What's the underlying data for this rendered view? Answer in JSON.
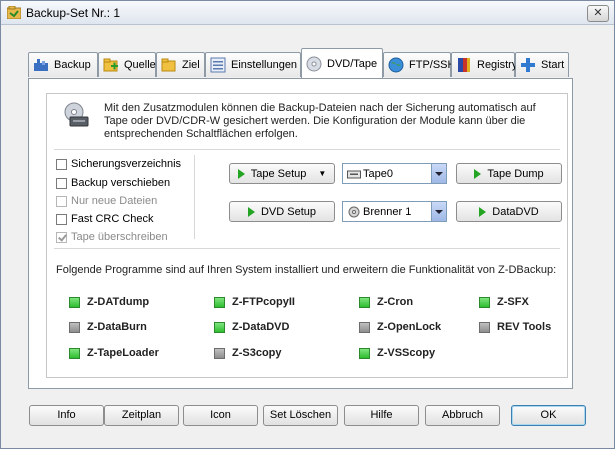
{
  "window": {
    "title": "Backup-Set Nr.: 1",
    "close_label": "✕"
  },
  "tabs": [
    {
      "label": "Backup",
      "icon": "backup-icon"
    },
    {
      "label": "Quelle",
      "icon": "source-folder-icon"
    },
    {
      "label": "Ziel",
      "icon": "target-folder-icon"
    },
    {
      "label": "Einstellungen",
      "icon": "settings-icon"
    },
    {
      "label": "DVD/Tape",
      "icon": "cd-icon",
      "active": true
    },
    {
      "label": "FTP/SSH",
      "icon": "globe-icon"
    },
    {
      "label": "Registry",
      "icon": "registry-icon"
    },
    {
      "label": "Start",
      "icon": "plus-icon"
    }
  ],
  "intro_text": "Mit den Zusatzmodulen  können die Backup-Dateien nach der Sicherung automatisch auf Tape oder DVD/CDR-W gesichert werden. Die Konfiguration der Module kann über die entsprechenden Schaltflächen erfolgen.",
  "options": [
    {
      "label": "Sicherungsverzeichnis",
      "checked": false,
      "enabled": true
    },
    {
      "label": "Backup verschieben",
      "checked": false,
      "enabled": true
    },
    {
      "label": "Nur neue Dateien",
      "checked": false,
      "enabled": false
    },
    {
      "label": "Fast CRC Check",
      "checked": false,
      "enabled": true
    },
    {
      "label": "Tape überschreiben",
      "checked": true,
      "enabled": false
    }
  ],
  "tape": {
    "setup_label": "Tape Setup",
    "device": "Tape0",
    "dump_label": "Tape Dump"
  },
  "dvd": {
    "setup_label": "DVD Setup",
    "device": "Brenner 1",
    "data_label": "DataDVD"
  },
  "installed_text": "Folgende Programme sind auf Ihren System installiert und erweitern die Funktionalität von Z-DBackup:",
  "modules": [
    {
      "name": "Z-DATdump",
      "installed": true
    },
    {
      "name": "Z-FTPcopyII",
      "installed": true
    },
    {
      "name": "Z-Cron",
      "installed": true
    },
    {
      "name": "Z-SFX",
      "installed": true
    },
    {
      "name": "Z-DataBurn",
      "installed": false
    },
    {
      "name": "Z-DataDVD",
      "installed": true
    },
    {
      "name": "Z-OpenLock",
      "installed": false
    },
    {
      "name": "REV Tools",
      "installed": false
    },
    {
      "name": "Z-TapeLoader",
      "installed": true
    },
    {
      "name": "Z-S3copy",
      "installed": false
    },
    {
      "name": "Z-VSScopy",
      "installed": true
    }
  ],
  "buttons": {
    "info": "Info",
    "zeitplan": "Zeitplan",
    "icon": "Icon",
    "set_loeschen": "Set Löschen",
    "hilfe": "Hilfe",
    "abbruch": "Abbruch",
    "ok": "OK"
  },
  "colors": {
    "installed": "#2fbd2f",
    "not_installed": "#8e8e8e",
    "play": "#23a523"
  }
}
